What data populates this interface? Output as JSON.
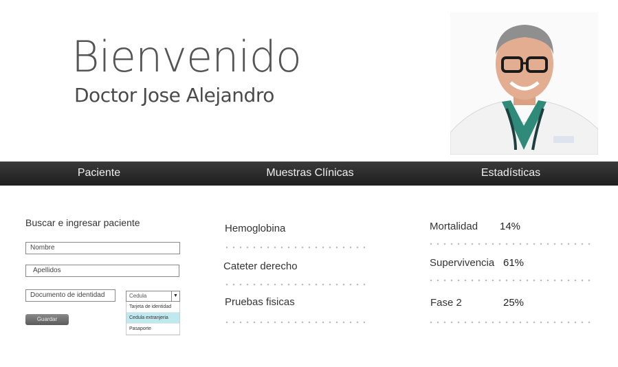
{
  "header": {
    "welcome": "Bienvenido",
    "doctor_name": "Doctor Jose Alejandro"
  },
  "nav": {
    "items": [
      {
        "label": "Paciente"
      },
      {
        "label": "Muestras Clínicas"
      },
      {
        "label": "Estadísticas"
      }
    ]
  },
  "patient_form": {
    "title": "Buscar e ingresar paciente",
    "name_placeholder": "Nombre",
    "surname_placeholder": "Apellidos",
    "document_placeholder": "Documento de identidad",
    "document_type": {
      "selected": "Cedula",
      "options": [
        "Tarjeta de identidad",
        "Cedula extranjeria",
        "Pasaporte"
      ],
      "highlighted": "Cedula extranjeria"
    },
    "save_label": "Guardar"
  },
  "samples": {
    "items": [
      {
        "label": "Hemoglobina"
      },
      {
        "label": "Cateter derecho"
      },
      {
        "label": "Pruebas fisicas"
      }
    ]
  },
  "stats": {
    "items": [
      {
        "label": "Mortalidad",
        "value": "14%"
      },
      {
        "label": "Supervivencia",
        "value": "61%"
      },
      {
        "label": "Fase 2",
        "value": "25%"
      }
    ]
  },
  "colors": {
    "navbar": "#2a2a2a",
    "highlight": "#bfe8ef"
  }
}
